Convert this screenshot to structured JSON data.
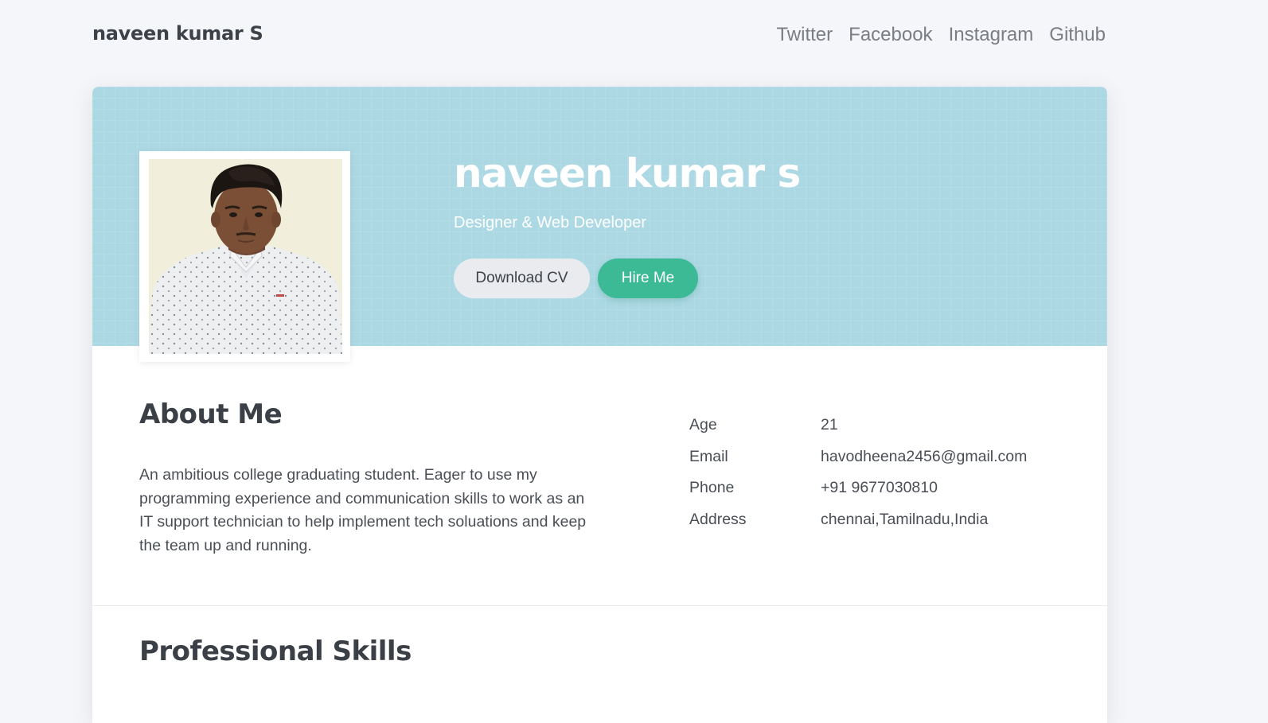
{
  "header": {
    "brand": "naveen kumar S",
    "nav": [
      "Twitter",
      "Facebook",
      "Instagram",
      "Github"
    ]
  },
  "hero": {
    "name": "naveen kumar s",
    "role": "Designer & Web Developer",
    "download_cv_label": "Download CV",
    "hire_me_label": "Hire Me",
    "background_color": "#acd8e4",
    "accent_color": "#3cba95"
  },
  "about": {
    "title": "About Me",
    "text": "An ambitious college graduating student. Eager to use my programming experience and communication skills to work as an IT support technician to help implement tech soluations and keep the team up and running.",
    "info": [
      {
        "label": "Age",
        "value": "21"
      },
      {
        "label": "Email",
        "value": "havodheena2456@gmail.com"
      },
      {
        "label": "Phone",
        "value": "+91 9677030810"
      },
      {
        "label": "Address",
        "value": "chennai,Tamilnadu,India"
      }
    ]
  },
  "skills": {
    "title": "Professional Skills"
  }
}
